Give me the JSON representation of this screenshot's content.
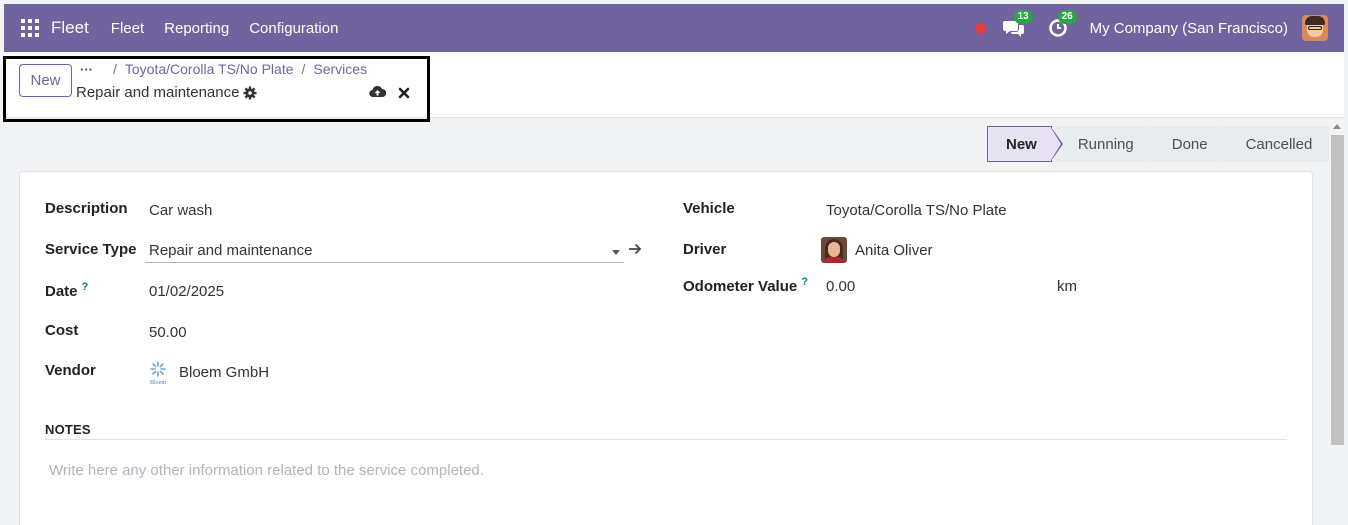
{
  "navbar": {
    "brand": "Fleet",
    "menu": [
      "Fleet",
      "Reporting",
      "Configuration"
    ],
    "messages_count": "13",
    "activities_count": "26",
    "company": "My Company (San Francisco)"
  },
  "control": {
    "new_button": "New",
    "breadcrumb_dots": "···",
    "breadcrumb": [
      "Toyota/Corolla TS/No Plate",
      "Services"
    ],
    "separator": "/",
    "record_title": "Repair and maintenance"
  },
  "status": {
    "stages": [
      "New",
      "Running",
      "Done",
      "Cancelled"
    ],
    "active": "New"
  },
  "form": {
    "left": {
      "description_label": "Description",
      "description_value": "Car wash",
      "service_type_label": "Service Type",
      "service_type_value": "Repair and maintenance",
      "date_label": "Date",
      "date_value": "01/02/2025",
      "cost_label": "Cost",
      "cost_value": "50.00",
      "vendor_label": "Vendor",
      "vendor_value": "Bloem GmbH",
      "vendor_logo_text": "Bloem"
    },
    "right": {
      "vehicle_label": "Vehicle",
      "vehicle_value": "Toyota/Corolla TS/No Plate",
      "driver_label": "Driver",
      "driver_value": "Anita Oliver",
      "odometer_label": "Odometer Value",
      "odometer_value": "0.00",
      "odometer_unit": "km"
    },
    "help_mark": "?",
    "notes_title": "NOTES",
    "notes_placeholder": "Write here any other information related to the service completed."
  },
  "colors": {
    "brand": "#71639e",
    "badge": "#28a745",
    "record": "#e83e3e",
    "help": "#017e84"
  }
}
